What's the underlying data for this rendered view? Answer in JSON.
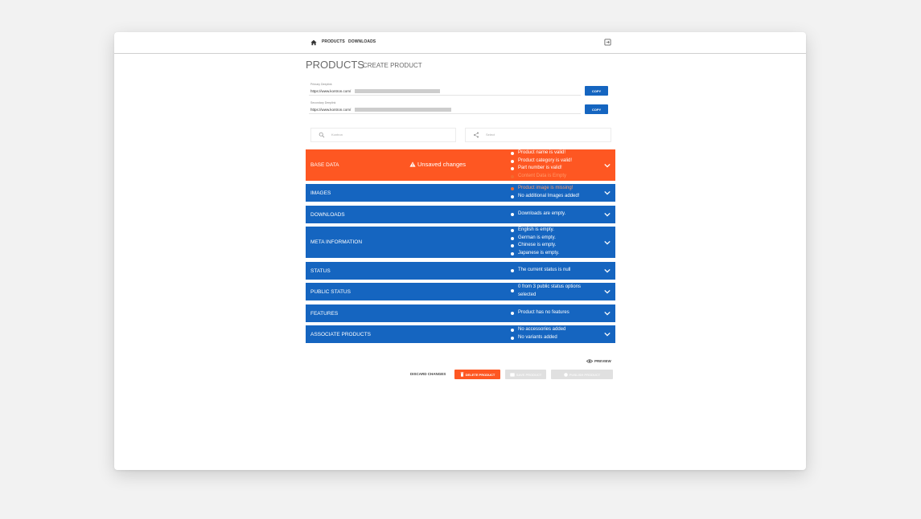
{
  "nav": {
    "links": [
      "PRODUCTS",
      "DOWNLOADS"
    ]
  },
  "header": {
    "title": "PRODUCTS",
    "subtitle": "CREATE PRODUCT"
  },
  "links": [
    {
      "label": "Primary Deeplink",
      "value": "https://www.kontron.com/",
      "copy_label": "COPY"
    },
    {
      "label": "Secondary Deeplink",
      "value": "https://www.kontron.com/",
      "copy_label": "COPY"
    }
  ],
  "search": {
    "left_placeholder": "Kontron",
    "right_placeholder": "Select"
  },
  "panels": [
    {
      "label": "BASE DATA",
      "status": "Unsaved changes",
      "color": "#fe5722",
      "checks": [
        {
          "text": "Product name is valid!",
          "state": "ok"
        },
        {
          "text": "Product category is valid!",
          "state": "ok"
        },
        {
          "text": "Part number is valid!",
          "state": "ok"
        },
        {
          "text": "Content Data is Empty",
          "state": "error"
        }
      ]
    },
    {
      "label": "IMAGES",
      "color": "#1565c0",
      "checks": [
        {
          "text": "Product image is missing!",
          "state": "error"
        },
        {
          "text": "No additional Images added!",
          "state": "ok"
        }
      ]
    },
    {
      "label": "DOWNLOADS",
      "color": "#1565c0",
      "checks": [
        {
          "text": "Downloads are empty.",
          "state": "ok"
        }
      ]
    },
    {
      "label": "META INFORMATION",
      "color": "#1565c0",
      "checks": [
        {
          "text": "English is empty.",
          "state": "ok"
        },
        {
          "text": "German is empty.",
          "state": "ok"
        },
        {
          "text": "Chinese is empty.",
          "state": "ok"
        },
        {
          "text": "Japanese is empty.",
          "state": "ok"
        }
      ]
    },
    {
      "label": "STATUS",
      "color": "#1565c0",
      "checks": [
        {
          "text": "The current status is null",
          "state": "ok"
        }
      ]
    },
    {
      "label": "PUBLIC STATUS",
      "color": "#1565c0",
      "checks": [
        {
          "text": "0 from 3 public status options selected",
          "state": "ok"
        }
      ]
    },
    {
      "label": "FEATURES",
      "color": "#1565c0",
      "checks": [
        {
          "text": "Product has no features",
          "state": "ok"
        }
      ]
    },
    {
      "label": "ASSOCIATE PRODUCTS",
      "color": "#1565c0",
      "checks": [
        {
          "text": "No accessories added",
          "state": "ok"
        },
        {
          "text": "No variants added",
          "state": "ok"
        }
      ]
    }
  ],
  "actions": {
    "preview": "PREVIEW",
    "discard": "DISCARD CHANGES",
    "delete": "DELETE PRODUCT",
    "save": "SAVE PRODUCT",
    "publish": "PUBLISH PRODUCT"
  },
  "colors": {
    "accent_blue": "#1565c0",
    "accent_orange": "#fe5722",
    "error_dot": "#f26a2e"
  }
}
